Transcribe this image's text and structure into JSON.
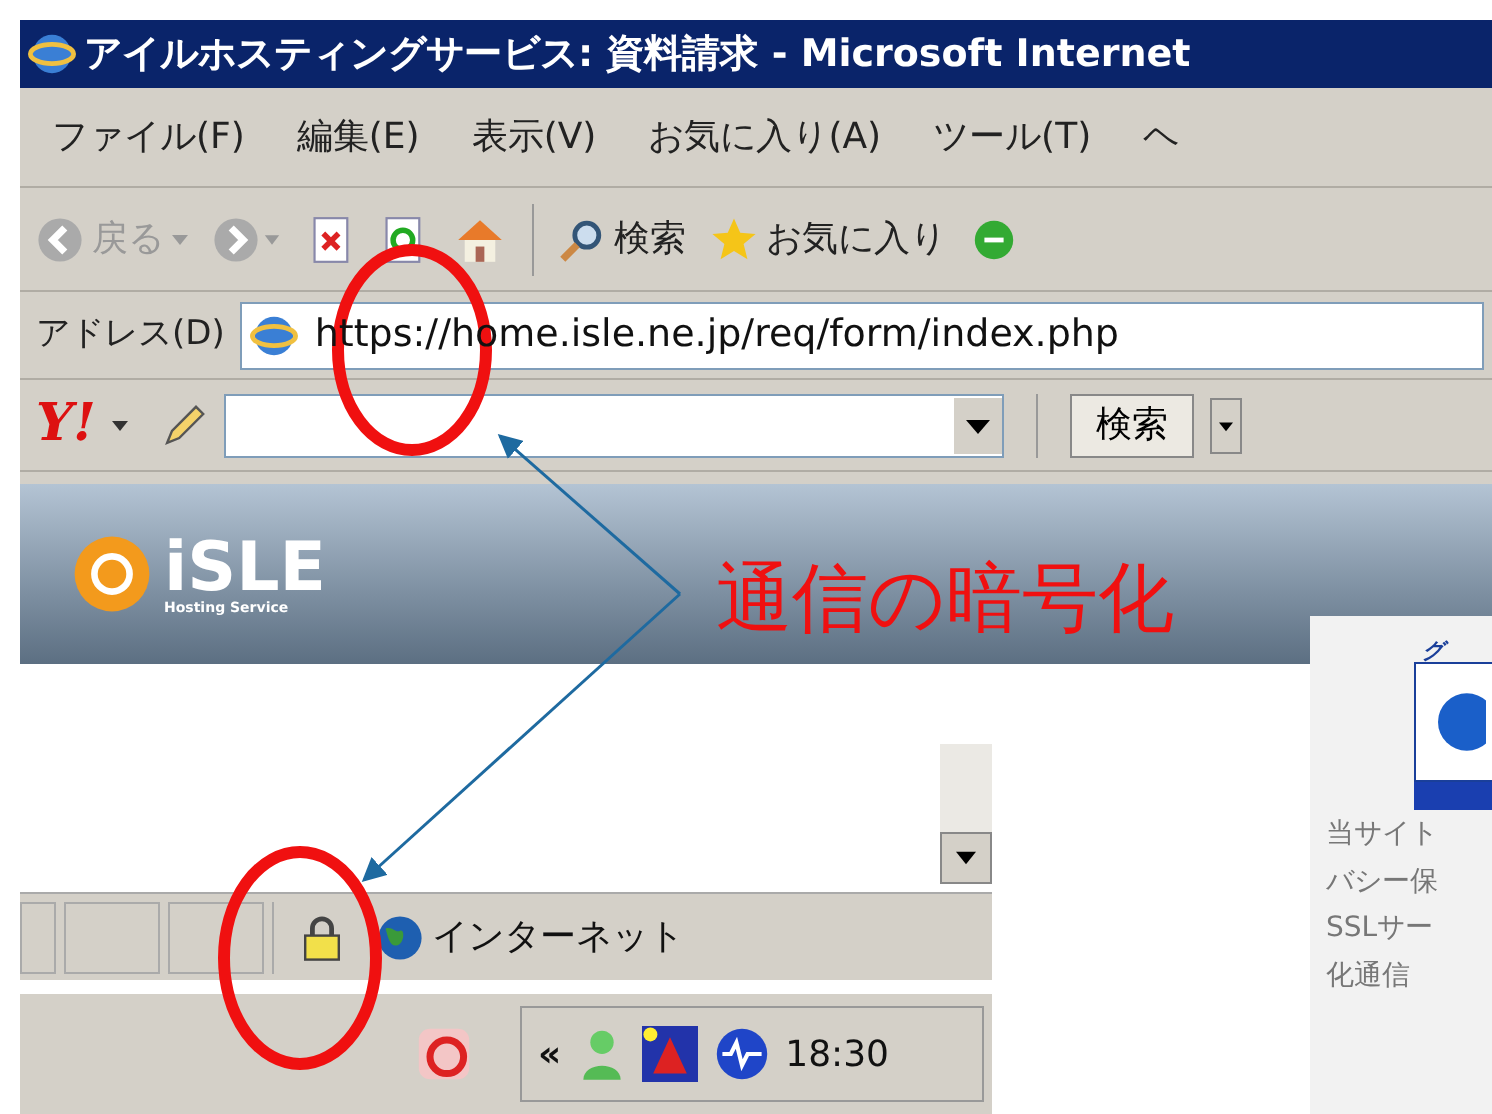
{
  "window": {
    "title": "アイルホスティングサービス: 資料請求 - Microsoft Internet"
  },
  "menu": [
    {
      "label": "ファイル(F)"
    },
    {
      "label": "編集(E)"
    },
    {
      "label": "表示(V)"
    },
    {
      "label": "お気に入り(A)"
    },
    {
      "label": "ツール(T)"
    },
    {
      "label": "ヘ"
    }
  ],
  "toolbar": {
    "back": "戻る",
    "search": "検索",
    "favorites": "お気に入り"
  },
  "address": {
    "label": "アドレス(D)",
    "url": "https://home.isle.ne.jp/req/form/index.php"
  },
  "yahoo_bar": {
    "logo": "Y!",
    "search_button": "検索"
  },
  "banner": {
    "logo": "iSLE",
    "tagline": "Hosting Service"
  },
  "annotation": {
    "text": "通信の暗号化"
  },
  "status_bar": {
    "zone": "インターネット",
    "secure": true
  },
  "taskbar": {
    "expand": "«",
    "clock": "18:30"
  },
  "side_panel": {
    "heading": "グ",
    "lines": [
      "当サイト",
      "バシー保",
      "SSLサー",
      "化通信"
    ]
  }
}
